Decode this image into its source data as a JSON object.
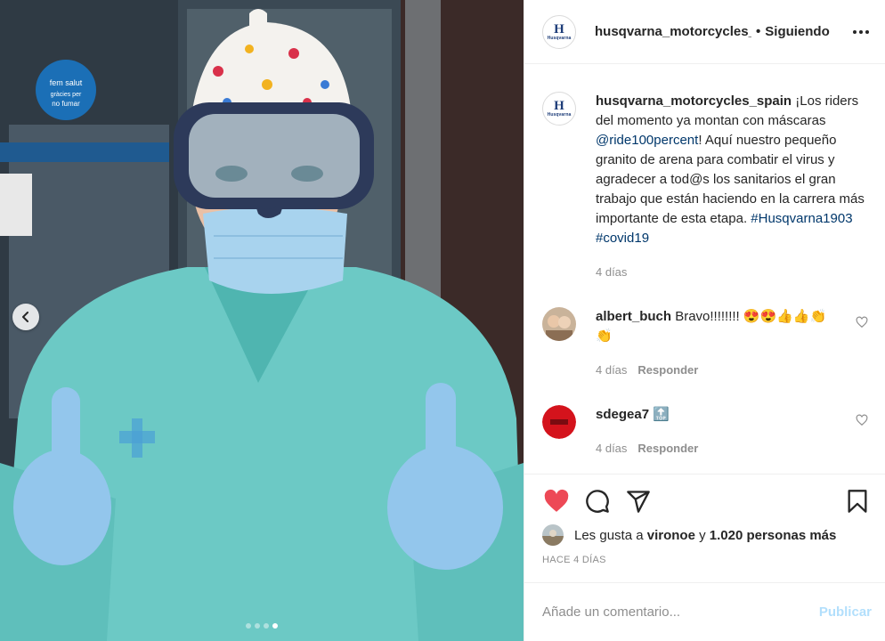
{
  "post": {
    "username": "husqvarna_motorcycles_spain",
    "username_header": "husqvarna_motorcycles_spain",
    "separator": "•",
    "follow_status": "Siguiendo",
    "logo_mark": "H",
    "logo_word": "Husqvarna"
  },
  "photo": {
    "sign_text_1": "fem salut",
    "sign_text_2": "gràcies per",
    "sign_text_3": "no fumar",
    "carousel_count": 4,
    "carousel_active": 4
  },
  "caption": {
    "text_1": "¡Los riders del momento ya montan con máscaras ",
    "mention": "@ride100percent",
    "text_2": "! Aquí nuestro pequeño granito de arena para combatir el virus y agradecer a tod@s los sanitarios el gran trabajo que están haciendo en la carrera más importante de esta etapa. ",
    "tag_1": "#Husqvarna1903",
    "tag_2": "#covid19",
    "time": "4 días"
  },
  "comments": [
    {
      "username": "albert_buch",
      "text": "Bravo!!!!!!!! 😍😍👍👍👏👏",
      "time": "4 días",
      "reply": "Responder"
    },
    {
      "username": "sdegea7",
      "text": "🔝",
      "time": "4 días",
      "reply": "Responder"
    }
  ],
  "likes": {
    "prefix": "Les gusta a",
    "user": "vironoe",
    "connector": "y",
    "others": "1.020 personas más"
  },
  "timestamp": "HACE 4 DÍAS",
  "add_comment": {
    "placeholder": "Añade un comentario...",
    "publish": "Publicar"
  },
  "colors": {
    "like_red": "#ed4956",
    "link_blue": "#00376b",
    "publish_disabled": "#b2dffc"
  }
}
